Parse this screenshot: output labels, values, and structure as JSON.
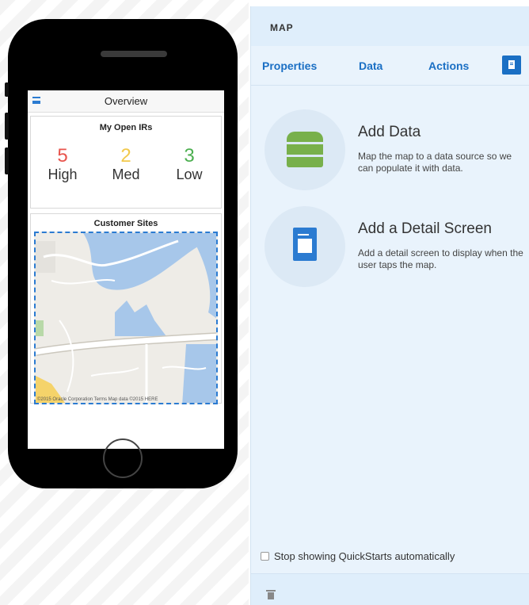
{
  "device_preview": {
    "screen_title": "Overview",
    "irs_card": {
      "title": "My Open IRs",
      "items": [
        {
          "count": "5",
          "label": "High",
          "color": "#e8554e"
        },
        {
          "count": "2",
          "label": "Med",
          "color": "#f2c94c"
        },
        {
          "count": "3",
          "label": "Low",
          "color": "#4caf50"
        }
      ]
    },
    "sites_card": {
      "title": "Customer Sites",
      "map_credit": "©2015 Oracle Corporation  Terms  Map data ©2015 HERE"
    }
  },
  "panel": {
    "title": "MAP",
    "tabs": {
      "properties": "Properties",
      "data": "Data",
      "actions": "Actions"
    },
    "quickstarts": [
      {
        "title": "Add Data",
        "description": "Map the map to a data source so we can populate it with data.",
        "icon": "database-icon"
      },
      {
        "title": "Add a Detail Screen",
        "description": "Add a detail screen to display when the user taps the map.",
        "icon": "document-icon"
      }
    ],
    "stop_showing_label": "Stop showing QuickStarts automatically"
  },
  "colors": {
    "accent": "#1a6fc4",
    "panel_bg": "#e9f3fc",
    "db_green": "#78b04b"
  }
}
